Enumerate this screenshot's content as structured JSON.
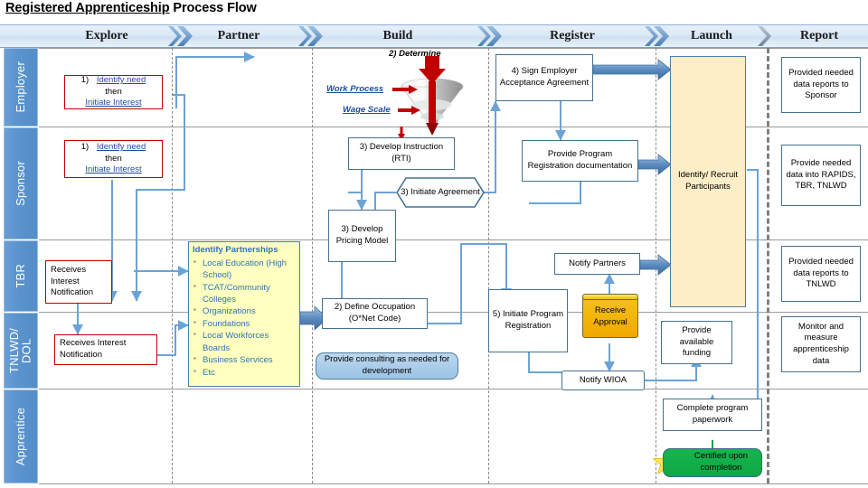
{
  "title": {
    "underlined": "Registered Apprenticeship",
    "rest": " Process Flow"
  },
  "phases": [
    {
      "label": "Explore"
    },
    {
      "label": "Partner"
    },
    {
      "label": "Build"
    },
    {
      "label": "Register"
    },
    {
      "label": "Launch"
    },
    {
      "label": "Report"
    }
  ],
  "lanes": [
    {
      "label": "Employer"
    },
    {
      "label": "Sponsor"
    },
    {
      "label": "TBR"
    },
    {
      "label": "TNLWD/\nDOL"
    },
    {
      "label": "Apprentice"
    }
  ],
  "nodes": {
    "employer_identify": {
      "num": "1)",
      "link1": "Identify need",
      "then": "then",
      "link2": "Initiate Interest"
    },
    "sponsor_identify": {
      "num": "1)",
      "link1": "Identify need",
      "then": "then",
      "link2": "Initiate Interest"
    },
    "determine_caption": "2) Determine",
    "work_process": "Work Process",
    "wage_scale": "Wage Scale",
    "sign_employer_agreement": "4) Sign Employer Acceptance Agreement",
    "report_sponsor": "Provided needed data reports to Sponsor",
    "develop_instruction": "3) Develop Instruction (RTI)",
    "initiate_agreement": "3) Initiate Agreement",
    "provide_program_registration": "Provide Program Registration documentation",
    "identify_recruit": "Identify/ Recruit Participants",
    "report_rapids": "Provide needed data into RAPIDS, TBR, TNLWD",
    "develop_pricing": "3) Develop Pricing Model",
    "receives_interest_notification_tbr": "Receives Interest Notification",
    "receives_interest_notification_dol": "Receives Interest Notification",
    "notify_partners": "Notify Partners",
    "report_tnlwd": "Provided needed data reports to TNLWD",
    "identify_partnerships": {
      "title": "Identify Partnerships",
      "items": [
        "Local Education (High School)",
        "TCAT/Community Colleges",
        "Organizations",
        "Foundations",
        "Local Workforces Boards",
        "Business Services",
        "Etc"
      ]
    },
    "define_occupation": "2) Define Occupation (O*Net Code)",
    "provide_consulting": "Provide consulting as needed for development",
    "initiate_program_registration": "5) Initiate Program Registration",
    "receive_approval": "Receive Approval",
    "provide_available_funding": "Provide available funding",
    "monitor_measure": "Monitor and measure apprenticeship data",
    "notify_wioa": "Notify WIOA",
    "complete_paperwork": "Complete program paperwork",
    "certified": "Certified upon completion"
  },
  "colors": {
    "lane_header": "#548dc9",
    "phase_band": "#dbe9f7",
    "box_border_blue": "#44718f",
    "box_border_red": "#c00000",
    "cream": "#fdeec8",
    "note_yellow": "#ffffbf",
    "green": "#10a845",
    "gold": "#f0a800",
    "connector": "#6ba3d6",
    "funnel_red": "#c00000"
  }
}
